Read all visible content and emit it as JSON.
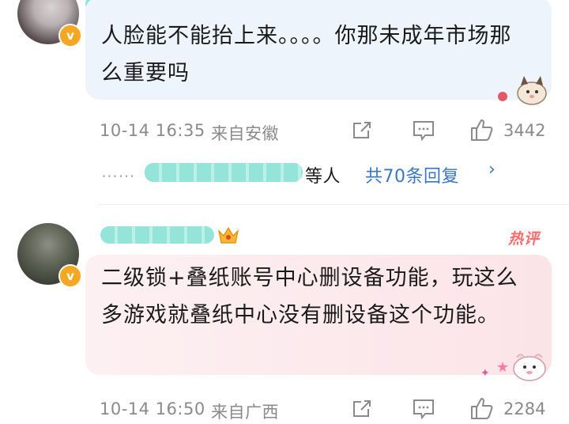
{
  "comments": [
    {
      "text": "人脸能不能抬上来。。。。你那未成年市场那么重要吗",
      "date": "10-14 16:35",
      "location": "来自安徽",
      "likes": "3442",
      "badge": "v",
      "replies": {
        "ellipsis": "……",
        "suffix": "等人",
        "link": "共70条回复",
        "chevron": "›"
      }
    },
    {
      "hot_label": "热评",
      "text": "二级锁+叠纸账号中心删设备功能，玩这么多游戏就叠纸中心没有删设备这个功能。",
      "date": "10-14 16:50",
      "location": "来自广西",
      "likes": "2284",
      "badge": "v"
    }
  ],
  "colors": {
    "accent_link": "#3a76c6",
    "meta_gray": "#8a8a8a",
    "hot": "#ff6a6a",
    "badge": "#f5a623"
  },
  "icons": [
    "share-icon",
    "comment-icon",
    "like-icon",
    "crown-icon",
    "cat-sticker-icon"
  ]
}
